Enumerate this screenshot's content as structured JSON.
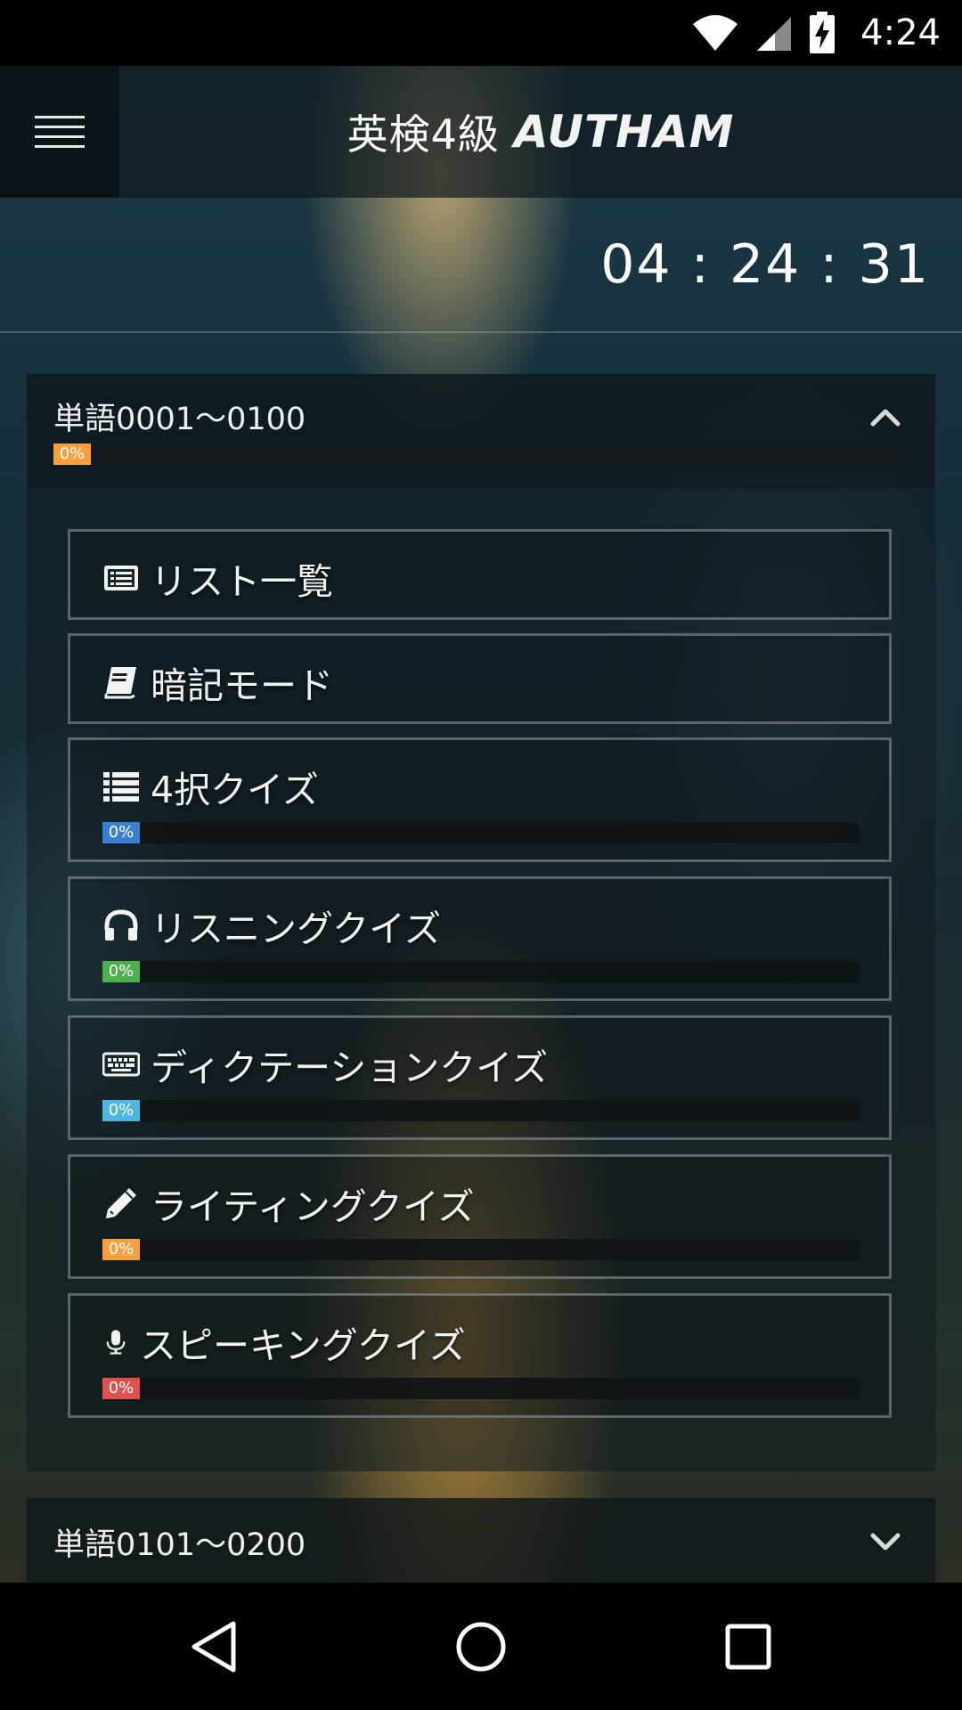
{
  "status_bar": {
    "time": "4:24",
    "icons": [
      "wifi-icon",
      "cell-signal-icon",
      "battery-charging-icon"
    ]
  },
  "app_bar": {
    "menu_icon": "hamburger-menu-icon",
    "title": "英検4級",
    "brand": "AUTHAM"
  },
  "clock": {
    "text": "04 : 24 : 31"
  },
  "sections": [
    {
      "title": "単語0001～0100",
      "expanded": true,
      "progress_label": "0%",
      "progress_color": "#f5a040",
      "items": [
        {
          "label": "リスト一覧",
          "icon": "list-icon"
        },
        {
          "label": "暗記モード",
          "icon": "book-icon"
        },
        {
          "label": "4択クイズ",
          "icon": "list-bullets-icon",
          "progress_label": "0%",
          "progress_color": "#3a7fd0"
        },
        {
          "label": "リスニングクイズ",
          "icon": "headphones-icon",
          "progress_label": "0%",
          "progress_color": "#4caf50"
        },
        {
          "label": "ディクテーションクイズ",
          "icon": "keyboard-icon",
          "progress_label": "0%",
          "progress_color": "#4fb6e0"
        },
        {
          "label": "ライティングクイズ",
          "icon": "pencil-icon",
          "progress_label": "0%",
          "progress_color": "#f5a040"
        },
        {
          "label": "スピーキングクイズ",
          "icon": "microphone-icon",
          "progress_label": "0%",
          "progress_color": "#e05050"
        }
      ]
    },
    {
      "title": "単語0101～0200",
      "expanded": false
    }
  ],
  "nav_bar": {
    "buttons": [
      "back-icon",
      "home-icon",
      "recents-icon"
    ]
  }
}
